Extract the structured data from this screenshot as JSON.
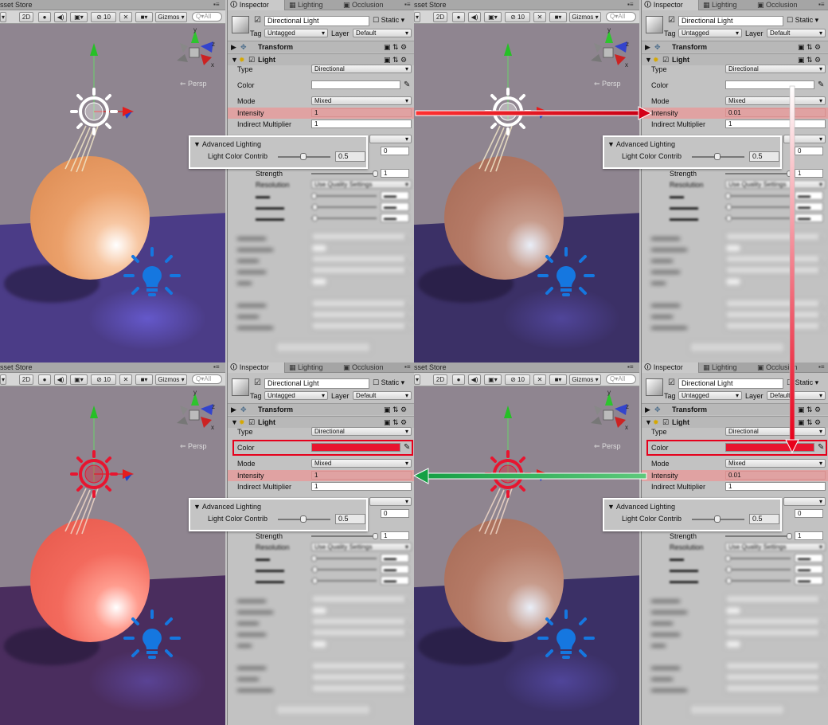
{
  "scene_toolbar": {
    "tab_title": "sset Store",
    "mode_2d": "2D",
    "hidden_count": "10",
    "gizmos_label": "Gizmos",
    "search_placeholder": "Q▾All",
    "persp_label": "Persp",
    "axis_labels": {
      "y": "y",
      "z": "z",
      "x": "x"
    }
  },
  "inspector": {
    "tabs": [
      "Inspector",
      "Lighting",
      "Occlusion"
    ],
    "object_name": "Directional Light",
    "static_label": "Static",
    "tag_label": "Tag",
    "tag_value": "Untagged",
    "layer_label": "Layer",
    "layer_value": "Default",
    "transform_label": "Transform",
    "light_label": "Light",
    "type_label": "Type",
    "type_value": "Directional",
    "color_label": "Color",
    "mode_label": "Mode",
    "mode_value": "Mixed",
    "intensity_label": "Intensity",
    "indirect_label": "Indirect Multiplier",
    "indirect_value": "1",
    "strength_label": "Strength",
    "strength_value": "1",
    "resolution_label": "Resolution",
    "resolution_value": "Use Quality Settings",
    "shadow_type_value": "0"
  },
  "advanced": {
    "title": "Advanced Lighting",
    "label": "Light Color Contrib",
    "value": "0.5"
  },
  "panels": [
    {
      "intensity": "1",
      "color": "#ffffff",
      "sun_color": "#ffffff",
      "sphere": "orange",
      "color_highlight": false
    },
    {
      "intensity": "0.01",
      "color": "#ffffff",
      "sun_color": "#ffffff",
      "sphere": "dim",
      "color_highlight": false
    },
    {
      "intensity": "1",
      "color": "#e8152f",
      "sun_color": "#e8152f",
      "sphere": "red",
      "color_highlight": true
    },
    {
      "intensity": "0.01",
      "color": "#e8152f",
      "sun_color": "#e8152f",
      "sphere": "dim",
      "color_highlight": true
    }
  ],
  "colors": {
    "arrow_red": "#e8001a",
    "arrow_green": "#17a34a",
    "highlight_row": "#e0a2a2",
    "bulb_blue": "#1577e0"
  }
}
